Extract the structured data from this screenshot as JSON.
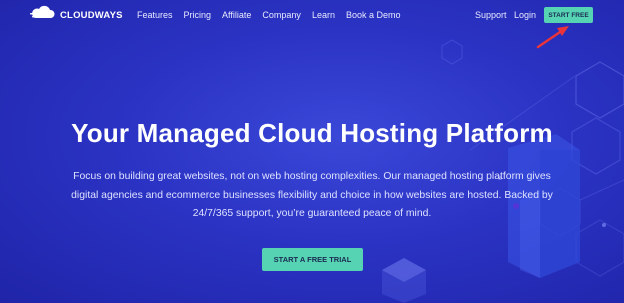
{
  "brand": {
    "name": "CLOUDWAYS",
    "logo_icon": "cloud-stack-icon"
  },
  "nav": {
    "links": [
      "Features",
      "Pricing",
      "Affiliate",
      "Company",
      "Learn",
      "Book a Demo"
    ],
    "support": "Support",
    "login": "Login",
    "start_free": "START FREE"
  },
  "hero": {
    "title": "Your Managed Cloud Hosting Platform",
    "description": "Focus on building great websites, not on web hosting complexities. Our managed hosting platform gives digital agencies and ecommerce businesses flexibility and choice in how websites are hosted. Backed by 24/7/365 support, you’re guaranteed peace of mind.",
    "cta": "START A FREE TRIAL"
  },
  "colors": {
    "background": "#2b33c4",
    "accent": "#55d3b2",
    "annotation_arrow": "#e8343a"
  }
}
